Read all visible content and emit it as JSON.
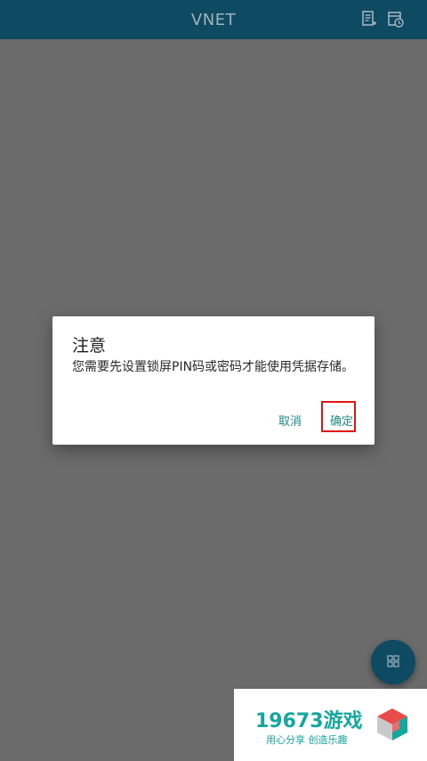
{
  "appbar": {
    "title": "VNET",
    "icons": [
      "list-add-icon",
      "calendar-clock-icon"
    ]
  },
  "dialog": {
    "title": "注意",
    "message": "您需要先设置锁屏PIN码或密码才能使用凭据存储。",
    "cancel_label": "取消",
    "ok_label": "确定"
  },
  "fab": {
    "icon": "grid-icon"
  },
  "watermark": {
    "title": "19673游戏",
    "subtitle": "用心分享 创造乐趣"
  },
  "colors": {
    "appbar": "#0f4a63",
    "overlay": "#6b6b6b",
    "button_text": "#1f8a87",
    "highlight": "#e01515",
    "watermark_text": "#13a89e"
  }
}
